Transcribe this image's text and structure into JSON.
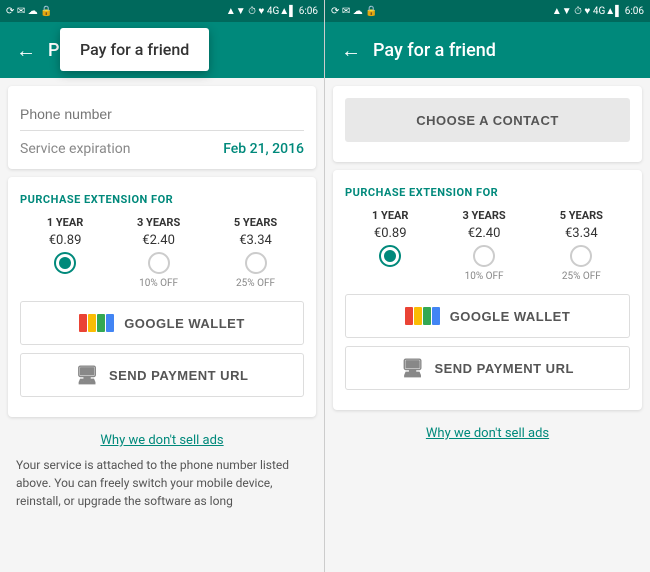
{
  "left_panel": {
    "status_bar": {
      "left": "⟳  ✉  ☁  🔒",
      "signal": "▲▼ ⏱ ♥ 4G▲▌ 6:06"
    },
    "app_bar_title": "Payment in...",
    "tooltip_text": "Pay for a friend",
    "phone_number_placeholder": "Phone number",
    "service_label": "Service expiration",
    "service_date": "Feb 21, 2016",
    "section_title": "PURCHASE EXTENSION FOR",
    "options": [
      {
        "years": "1 YEAR",
        "price": "€0.89",
        "discount": "",
        "selected": true
      },
      {
        "years": "3 YEARS",
        "price": "€2.40",
        "discount": "10% OFF",
        "selected": false
      },
      {
        "years": "5 YEARS",
        "price": "€3.34",
        "discount": "25% OFF",
        "selected": false
      }
    ],
    "google_wallet_label": "GOOGLE WALLET",
    "send_payment_label": "SEND PAYMENT URL",
    "why_link": "Why we don't sell ads",
    "bottom_text": "Your service is attached to the phone number listed above. You can freely switch your mobile device, reinstall, or upgrade the software as long"
  },
  "right_panel": {
    "status_bar": {
      "left": "⟳  ✉  ☁  🔒",
      "signal": "▲▼ ⏱ ♥ 4G▲▌ 6:06"
    },
    "app_bar_title": "Pay for a friend",
    "choose_contact_label": "CHOOSE A CONTACT",
    "section_title": "PURCHASE EXTENSION FOR",
    "options": [
      {
        "years": "1 YEAR",
        "price": "€0.89",
        "discount": "",
        "selected": true
      },
      {
        "years": "3 YEARS",
        "price": "€2.40",
        "discount": "10% OFF",
        "selected": false
      },
      {
        "years": "5 YEARS",
        "price": "€3.34",
        "discount": "25% OFF",
        "selected": false
      }
    ],
    "google_wallet_label": "GOOGLE WALLET",
    "send_payment_label": "SEND PAYMENT URL",
    "why_link": "Why we don't sell ads"
  }
}
